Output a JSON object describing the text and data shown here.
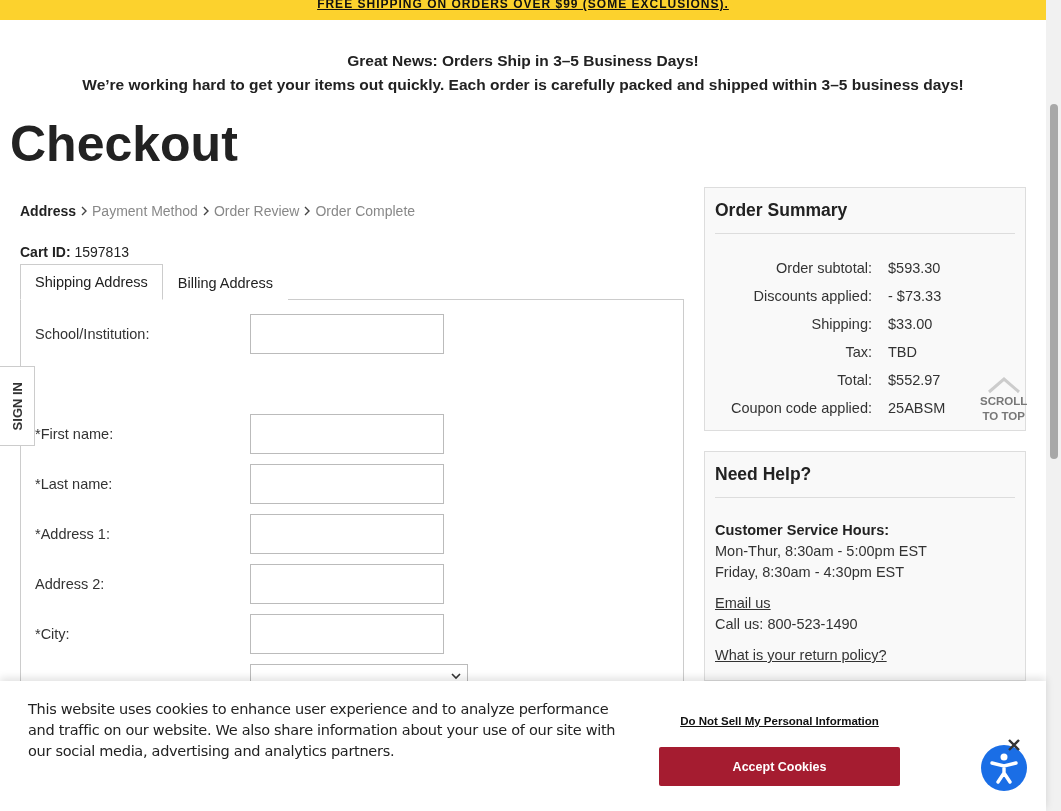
{
  "promo_bar": {
    "text": "FREE SHIPPING ON ORDERS OVER $99 (SOME EXCLUSIONS)."
  },
  "notice": {
    "title": "Great News: Orders Ship in 3–5 Business Days!",
    "text": "We’re working hard to get your items out quickly. Each order is carefully packed and shipped within 3–5 business days!"
  },
  "page_title": "Checkout",
  "breadcrumb": [
    {
      "label": "Address",
      "selected": true
    },
    {
      "label": "Payment Method",
      "selected": false
    },
    {
      "label": "Order Review",
      "selected": false
    },
    {
      "label": "Order Complete",
      "selected": false
    }
  ],
  "cart_id": {
    "label": "Cart ID:",
    "value": "1597813"
  },
  "tabs": [
    {
      "label": "Shipping Address",
      "selected": true
    },
    {
      "label": "Billing Address",
      "selected": false
    }
  ],
  "form": {
    "groups": [
      {
        "fields": [
          {
            "label": "School/Institution:",
            "kind": "text"
          }
        ]
      },
      {
        "fields": [
          {
            "label": "*First name:",
            "kind": "text"
          },
          {
            "label": "*Last name:",
            "kind": "text"
          },
          {
            "label": "*Address 1:",
            "kind": "text"
          },
          {
            "label": "Address 2:",
            "kind": "text"
          },
          {
            "label": "*City:",
            "kind": "text"
          },
          {
            "kind": "select"
          }
        ]
      }
    ]
  },
  "order_summary": {
    "title": "Order Summary",
    "rows": [
      {
        "label": "Order subtotal:",
        "value": "$593.30"
      },
      {
        "label": "Discounts applied:",
        "value": "- $73.33"
      },
      {
        "label": "Shipping:",
        "value": "$33.00"
      },
      {
        "label": "Tax:",
        "value": "TBD"
      },
      {
        "label": "Total:",
        "value": "$552.97"
      },
      {
        "label": "Coupon code applied:",
        "value": "25ABSM"
      }
    ]
  },
  "help": {
    "title": "Need Help?",
    "hours_title": "Customer Service Hours:",
    "hours": [
      "Mon-Thur, 8:30am - 5:00pm EST",
      "Friday, 8:30am - 4:30pm EST"
    ],
    "email_link": "Email us",
    "phone": "Call us: 800-523-1490",
    "return_link": "What is your return policy?"
  },
  "sign_in_tab": "SIGN IN",
  "scroll_to_top": [
    "SCROLL",
    "TO TOP"
  ],
  "cookie_banner": {
    "text": "This website uses cookies to enhance user experience and to analyze performance and traffic on our website. We also share information about your use of our site with our social media, advertising and analytics partners.",
    "link": "Do Not Sell My Personal Information",
    "button": "Accept Cookies"
  }
}
